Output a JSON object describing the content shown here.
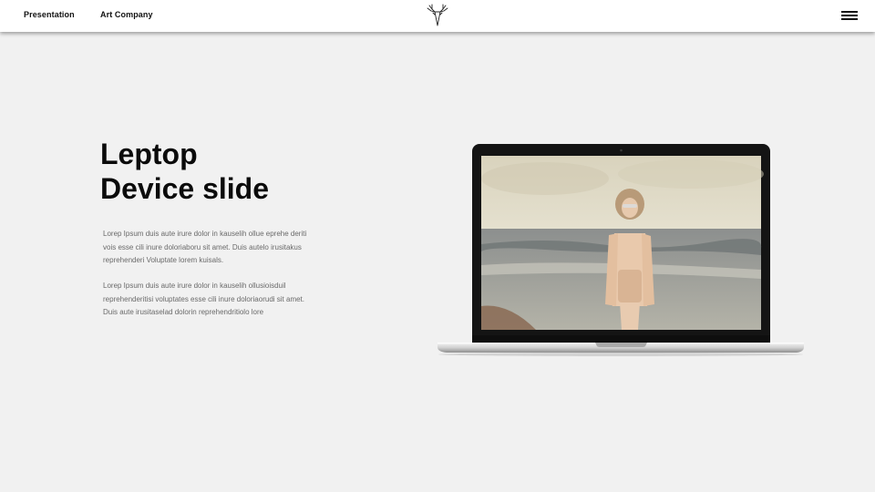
{
  "header": {
    "nav": [
      {
        "label": "Presentation"
      },
      {
        "label": "Art Company"
      }
    ],
    "logo_icon": "deer-head-icon",
    "menu_icon": "hamburger-menu-icon"
  },
  "slide": {
    "title_line1": "Leptop",
    "title_line2": "Device slide",
    "paragraphs": [
      "Lorep  Ipsum duis aute irure dolor in kauselih ollue eprehe deriti vois esse cili inure doloriaboru sit amet. Duis autelo irusitakus reprehenderi Voluptate lorem kuisals.",
      "Lorep  Ipsum duis aute irure dolor in kauselih ollusioisduil reprehenderitisi voluptates esse cili inure doloriaorudi sit amet. Duis aute irusitaselad dolorin reprehendritiolo lore"
    ]
  },
  "device": {
    "type": "laptop",
    "screen_image": "woman-on-beach-photo"
  },
  "colors": {
    "background": "#f1f1f1",
    "header": "#ffffff",
    "text_dark": "#0b0b0b",
    "text_muted": "#6a6a6a"
  }
}
